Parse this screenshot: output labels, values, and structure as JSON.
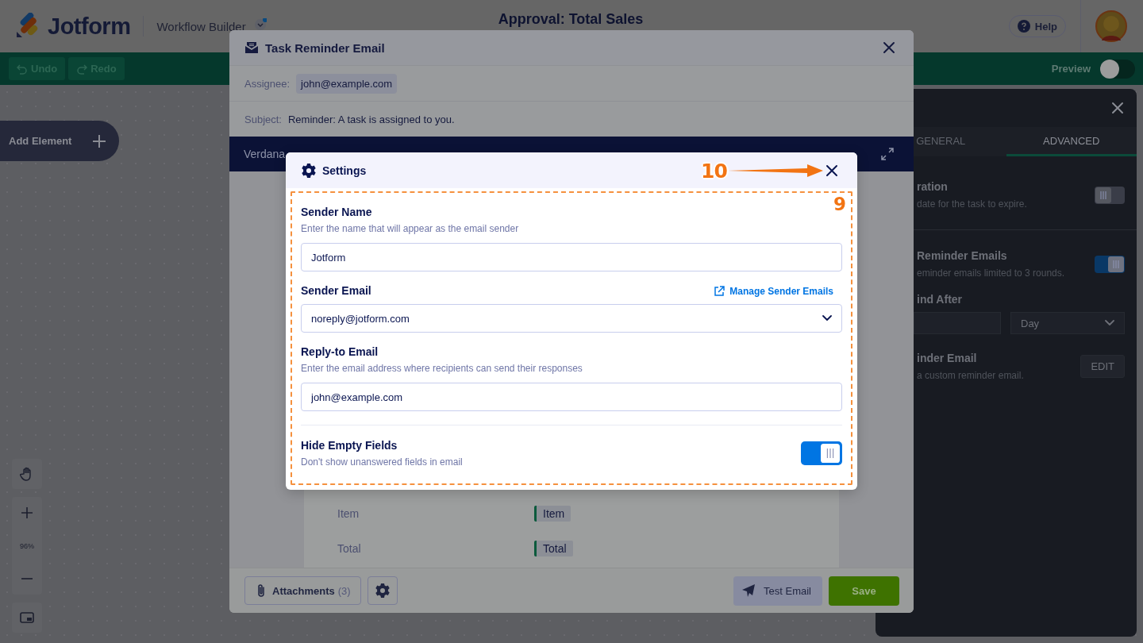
{
  "header": {
    "logo": "Jotform",
    "product": "Workflow Builder",
    "title": "Approval: Total Sales",
    "help": "Help"
  },
  "toolbar": {
    "undo": "Undo",
    "redo": "Redo",
    "preview": {
      "label": "Preview",
      "on": false
    }
  },
  "canvas": {
    "add_element": "Add Element",
    "zoom": "96%"
  },
  "properties_panel": {
    "tabs": [
      {
        "label": "GENERAL",
        "selected": false
      },
      {
        "label": "ADVANCED",
        "selected": true
      }
    ],
    "settings": [
      {
        "kind": "toggle",
        "title": "ration",
        "description": "date for the task to expire.",
        "on": false
      },
      {
        "kind": "toggle",
        "title": "Reminder Emails",
        "description": "eminder emails limited to 3 rounds.",
        "on": true
      },
      {
        "kind": "select",
        "title": "ind After",
        "value": "Day"
      },
      {
        "kind": "button",
        "title": "inder Email",
        "description": "a custom reminder email.",
        "button": "EDIT"
      }
    ]
  },
  "email_modal": {
    "title": "Task Reminder Email",
    "assignee_label": "Assignee:",
    "assignee": "john@example.com",
    "subject_label": "Subject:",
    "subject": "Reminder: A task is assigned to you.",
    "font": "Verdana",
    "rows": [
      {
        "label": "Item",
        "tag": "Item"
      },
      {
        "label": "Total",
        "tag": "Total"
      }
    ],
    "attachments": "Attachments",
    "attachments_count": "(3)",
    "test_email": "Test Email",
    "save": "Save"
  },
  "settings_modal": {
    "title": "Settings",
    "fields": [
      {
        "kind": "text",
        "label": "Sender Name",
        "hint": "Enter the name that will appear as the email sender",
        "value": "Jotform"
      },
      {
        "kind": "select",
        "label": "Sender Email",
        "link": "Manage Sender Emails",
        "value": "noreply@jotform.com"
      },
      {
        "kind": "text",
        "label": "Reply-to Email",
        "hint": "Enter the email address where recipients can send their responses",
        "value": "john@example.com"
      },
      {
        "kind": "toggle",
        "label": "Hide Empty Fields",
        "hint": "Don't show unanswered fields in email",
        "on": true
      }
    ]
  },
  "annotations": [
    {
      "kind": "arrow",
      "label": "10"
    },
    {
      "kind": "box",
      "label": "9"
    }
  ]
}
